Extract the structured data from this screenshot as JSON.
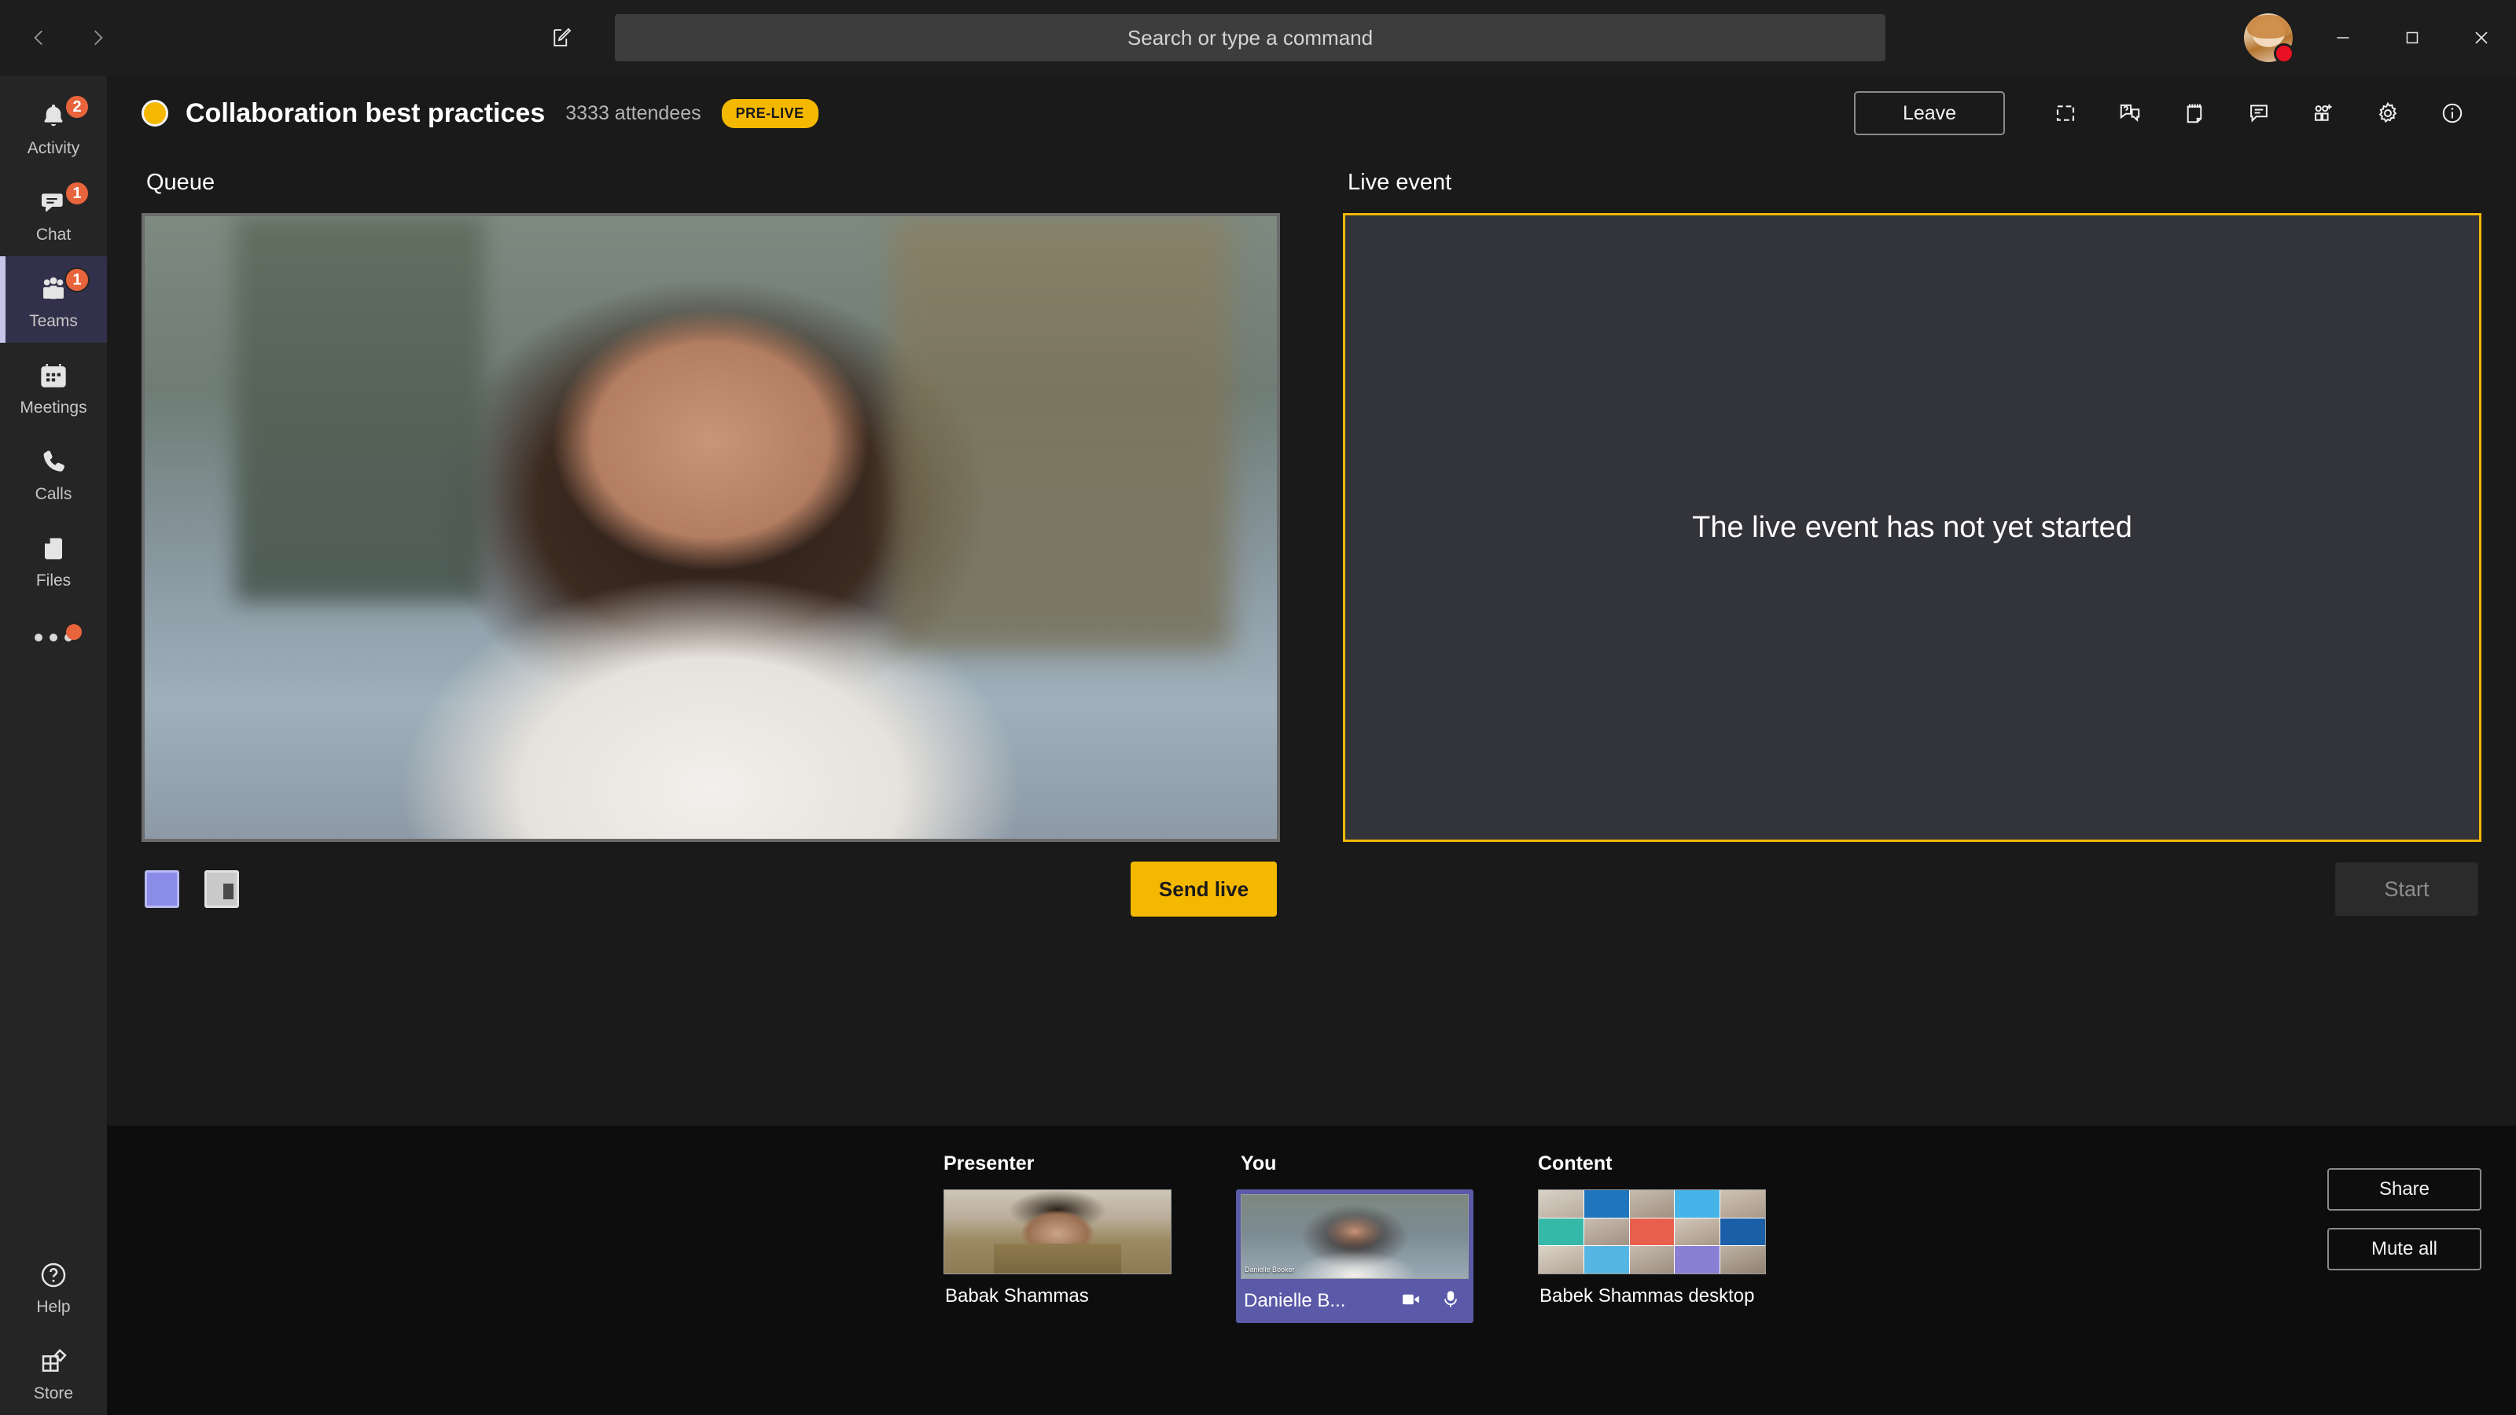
{
  "titlebar": {
    "back_icon": "chevron-left-icon",
    "forward_icon": "chevron-right-icon",
    "compose_icon": "compose-icon",
    "search_placeholder": "Search or type a command",
    "minimize_label": "Minimize",
    "maximize_label": "Maximize",
    "close_label": "Close",
    "avatar_status": "busy",
    "status_color": "#e81123"
  },
  "rail": {
    "items": [
      {
        "label": "Activity",
        "icon": "bell-icon",
        "badge": "2",
        "active": false
      },
      {
        "label": "Chat",
        "icon": "chat-icon",
        "badge": "1",
        "active": false
      },
      {
        "label": "Teams",
        "icon": "teams-icon",
        "badge": "1",
        "active": true
      },
      {
        "label": "Meetings",
        "icon": "calendar-icon",
        "badge": "",
        "active": false
      },
      {
        "label": "Calls",
        "icon": "phone-icon",
        "badge": "",
        "active": false
      },
      {
        "label": "Files",
        "icon": "file-icon",
        "badge": "",
        "active": false
      }
    ],
    "more": {
      "icon": "more-icon",
      "has_dot": true
    },
    "bottom_items": [
      {
        "label": "Help",
        "icon": "help-icon"
      },
      {
        "label": "Store",
        "icon": "store-icon"
      }
    ]
  },
  "header": {
    "title": "Collaboration best practices",
    "attendees": "3333 attendees",
    "state_badge": "PRE-LIVE",
    "state_badge_color": "#f5b800",
    "leave_label": "Leave",
    "icons": [
      {
        "name": "fullscreen-icon",
        "tooltip": "Full screen"
      },
      {
        "name": "qna-icon",
        "tooltip": "Q&A"
      },
      {
        "name": "notes-icon",
        "tooltip": "Meeting notes"
      },
      {
        "name": "chat-icon",
        "tooltip": "Chat"
      },
      {
        "name": "add-people-icon",
        "tooltip": "Add participants"
      },
      {
        "name": "settings-gear-icon",
        "tooltip": "Device settings"
      },
      {
        "name": "info-icon",
        "tooltip": "Event info"
      }
    ]
  },
  "queue": {
    "title": "Queue",
    "layout_single_label": "Single source layout",
    "layout_split_label": "Split layout",
    "send_live_label": "Send live"
  },
  "live_event": {
    "title": "Live event",
    "message": "The live event has not yet started",
    "start_label": "Start",
    "start_disabled": true,
    "border_color": "#f2b705"
  },
  "bottom": {
    "groups": [
      {
        "label": "Presenter",
        "caption": "Babak Shammas",
        "selected": false,
        "thumb": "presenter-video"
      },
      {
        "label": "You",
        "caption": "Danielle B...",
        "thumb_caption": "Danielle Booker",
        "selected": true,
        "thumb": "self-video",
        "camera_icon": "camera-icon",
        "mic_icon": "microphone-icon"
      },
      {
        "label": "Content",
        "caption": "Babek Shammas desktop",
        "selected": false,
        "thumb": "screen-share"
      }
    ],
    "share_label": "Share",
    "mute_all_label": "Mute all",
    "selection_color": "#5a5aa8"
  }
}
